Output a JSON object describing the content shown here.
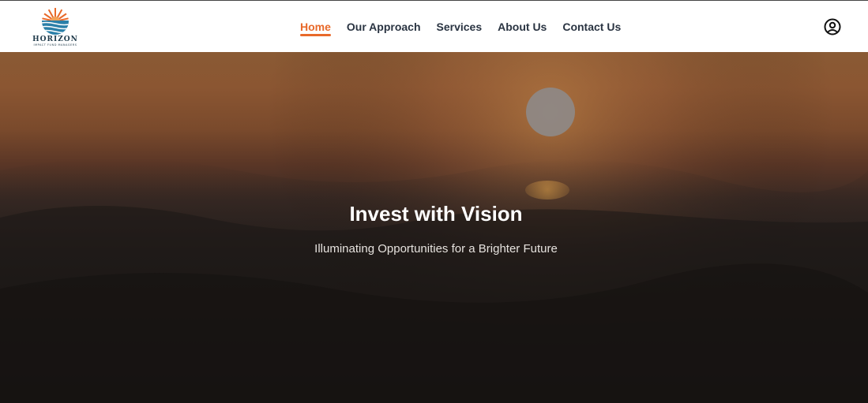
{
  "brand": {
    "name": "HORIZON",
    "tagline": "IMPACT FUND MANAGERS",
    "colors": {
      "accent": "#e8692a",
      "navText": "#2a3442",
      "logoBlue": "#2a7fa8"
    }
  },
  "nav": {
    "items": [
      {
        "label": "Home",
        "active": true
      },
      {
        "label": "Our Approach",
        "active": false
      },
      {
        "label": "Services",
        "active": false
      },
      {
        "label": "About Us",
        "active": false
      },
      {
        "label": "Contact Us",
        "active": false
      }
    ]
  },
  "header": {
    "user_icon": "user-circle-icon"
  },
  "hero": {
    "title": "Invest with Vision",
    "subtitle": "Illuminating Opportunities for a Brighter Future"
  }
}
